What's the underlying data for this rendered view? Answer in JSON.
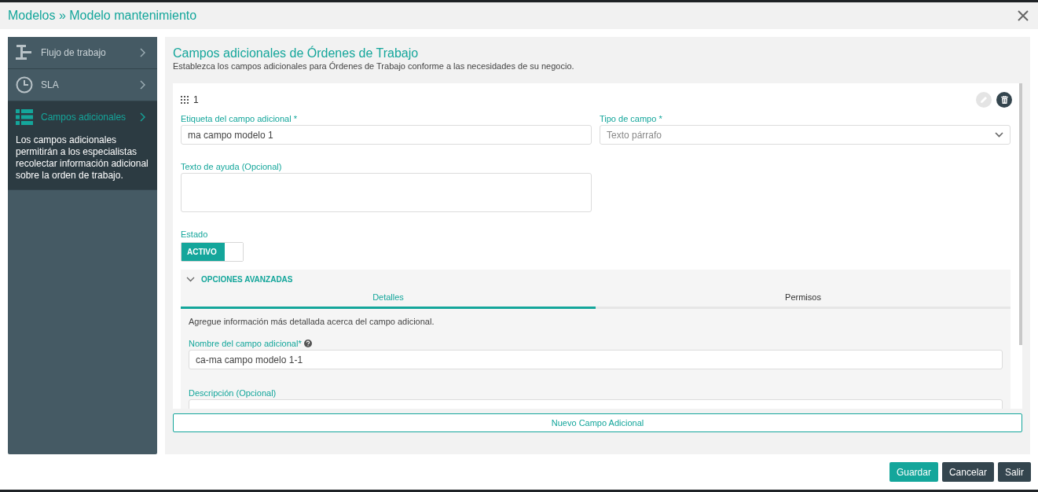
{
  "window": {
    "title": "Modelos » Modelo mantenimiento"
  },
  "sidebar": {
    "items": [
      {
        "kind": "workflow",
        "label": "Flujo de trabajo",
        "selected": false
      },
      {
        "kind": "clock",
        "label": "SLA",
        "selected": false
      },
      {
        "kind": "list",
        "label": "Campos adicionales",
        "selected": true,
        "description": "Los campos adicionales permitirán a los especialistas recolectar información adicional sobre la orden de trabajo."
      }
    ]
  },
  "section": {
    "title": "Campos adicionales de Órdenes de Trabajo",
    "subtitle": "Establezca los campos adicionales para Órdenes de Trabajo conforme a las necesidades de su negocio."
  },
  "field_card": {
    "number": "1",
    "edit_disabled": true,
    "label_field": {
      "label": "Etiqueta del campo adicional *",
      "value": "ma campo modelo 1"
    },
    "type_field": {
      "label": "Tipo de campo *",
      "value": "Texto párrafo"
    },
    "help_field": {
      "label": "Texto de ayuda (Opcional)"
    },
    "status": {
      "label": "Estado",
      "on": true,
      "text": "ACTIVO"
    },
    "advanced": {
      "title": "OPCIONES AVANZADAS",
      "expanded": true,
      "tabs": [
        {
          "label": "Detalles",
          "selected": true
        },
        {
          "label": "Permisos",
          "selected": false
        }
      ],
      "intro": "Agregue información más detallada acerca del campo adicional.",
      "name_field": {
        "label": "Nombre del campo adicional*",
        "value": "ca-ma campo modelo 1-1"
      },
      "description_field": {
        "label": "Descripción (Opcional)"
      }
    }
  },
  "add_button": "Nuevo Campo Adicional",
  "footer_buttons": [
    {
      "label": "Guardar",
      "kind": "primary"
    },
    {
      "label": "Cancelar",
      "kind": "secondary"
    },
    {
      "label": "Salir",
      "kind": "secondary"
    }
  ]
}
